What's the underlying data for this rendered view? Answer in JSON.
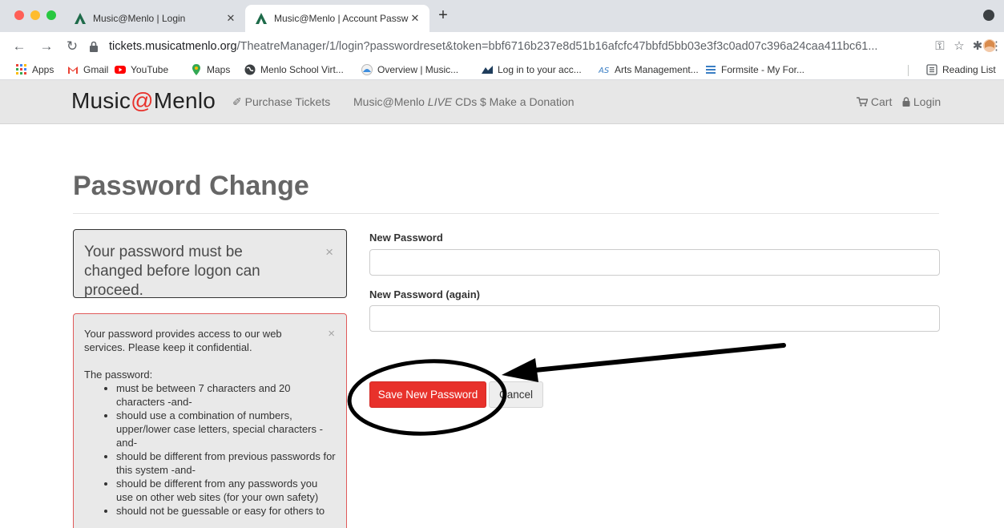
{
  "browser": {
    "tabs": [
      {
        "title": "Music@Menlo | Login",
        "active": false
      },
      {
        "title": "Music@Menlo | Account Passw",
        "active": true
      }
    ],
    "url_host": "tickets.musicatmenlo.org",
    "url_path": "/TheatreManager/1/login?passwordreset&token=bbf6716b237e8d51b16afcfc47bbfd5bb03e3f3c0ad07c396a24caa411bc61...",
    "bookmarks": [
      {
        "label": "Apps",
        "icon": "apps-grid-icon"
      },
      {
        "label": "Gmail",
        "icon": "gmail-icon"
      },
      {
        "label": "YouTube",
        "icon": "youtube-icon"
      },
      {
        "label": "Maps",
        "icon": "maps-icon"
      },
      {
        "label": "Menlo School Virt...",
        "icon": "globe-icon"
      },
      {
        "label": "Overview | Music...",
        "icon": "music-overview-icon"
      },
      {
        "label": "Log in to your acc...",
        "icon": "mountain-icon"
      },
      {
        "label": "Arts Management...",
        "icon": "arts-management-icon"
      },
      {
        "label": "Formsite - My For...",
        "icon": "formsite-icon"
      }
    ],
    "reading_list": "Reading List"
  },
  "site": {
    "brand_prefix": "Music",
    "brand_at": "@",
    "brand_suffix": "Menlo",
    "nav": {
      "purchase": "Purchase Tickets",
      "cds_prefix": "Music@Menlo ",
      "cds_italic": "LIVE",
      "cds_suffix": " CDs",
      "donation": "$ Make a Donation",
      "cart": "Cart",
      "login": "Login"
    }
  },
  "page": {
    "title": "Password Change",
    "change_alert": "Your password must be changed before logon can proceed.",
    "close_glyph": "×",
    "rules_intro": "Your password provides access to our web services. Please keep it confidential.",
    "rules_heading": "The password:",
    "rules": [
      "must be between 7 characters and 20 characters -and-",
      "should use a combination of numbers, upper/lower case letters, special characters -and-",
      "should be different from previous passwords for this system -and-",
      "should be different from any passwords you use on other web sites (for your own safety)",
      "should not be guessable or easy for others to"
    ],
    "new_password_label": "New Password",
    "new_password_again_label": "New Password (again)",
    "save_button": "Save New Password",
    "cancel_button": "Cancel"
  },
  "colors": {
    "accent": "#e8312b",
    "annotation": "#000000"
  }
}
